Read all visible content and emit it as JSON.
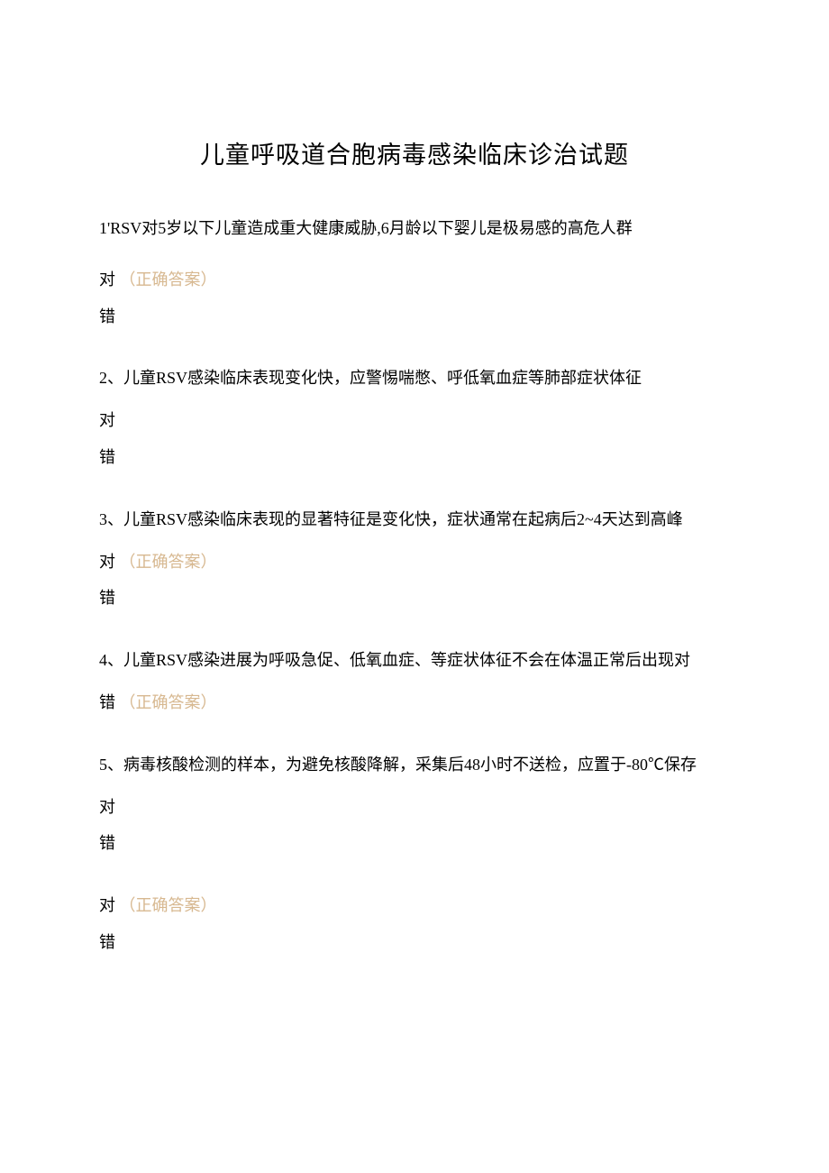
{
  "title": "儿童呼吸道合胞病毒感染临床诊治试题",
  "correct_label": "（正确答案）",
  "questions": [
    {
      "text": "1'RSV对5岁以下儿童造成重大健康威胁,6月龄以下婴儿是极易感的高危人群",
      "opts": [
        {
          "label": "对",
          "correct": true
        },
        {
          "label": "错",
          "correct": false
        }
      ]
    },
    {
      "text": "2、儿童RSV感染临床表现变化快，应警惕喘憋、呼低氧血症等肺部症状体征",
      "opts": [
        {
          "label": "对",
          "correct": false
        },
        {
          "label": "错",
          "correct": false
        }
      ]
    },
    {
      "text": "3、儿童RSV感染临床表现的显著特征是变化快，症状通常在起病后2~4天达到高峰",
      "opts": [
        {
          "label": "对",
          "correct": true
        },
        {
          "label": "错",
          "correct": false
        }
      ]
    },
    {
      "text": "4、儿童RSV感染进展为呼吸急促、低氧血症、等症状体征不会在体温正常后出现对",
      "opts": [
        {
          "label": "错",
          "correct": true
        }
      ]
    },
    {
      "text": "5、病毒核酸检测的样本，为避免核酸降解，采集后48小时不送检，应置于-80℃保存",
      "opts": [
        {
          "label": "对",
          "correct": false
        },
        {
          "label": "错",
          "correct": false
        }
      ]
    }
  ],
  "trailing": {
    "opts": [
      {
        "label": "对",
        "correct": true
      },
      {
        "label": "错",
        "correct": false
      }
    ]
  }
}
